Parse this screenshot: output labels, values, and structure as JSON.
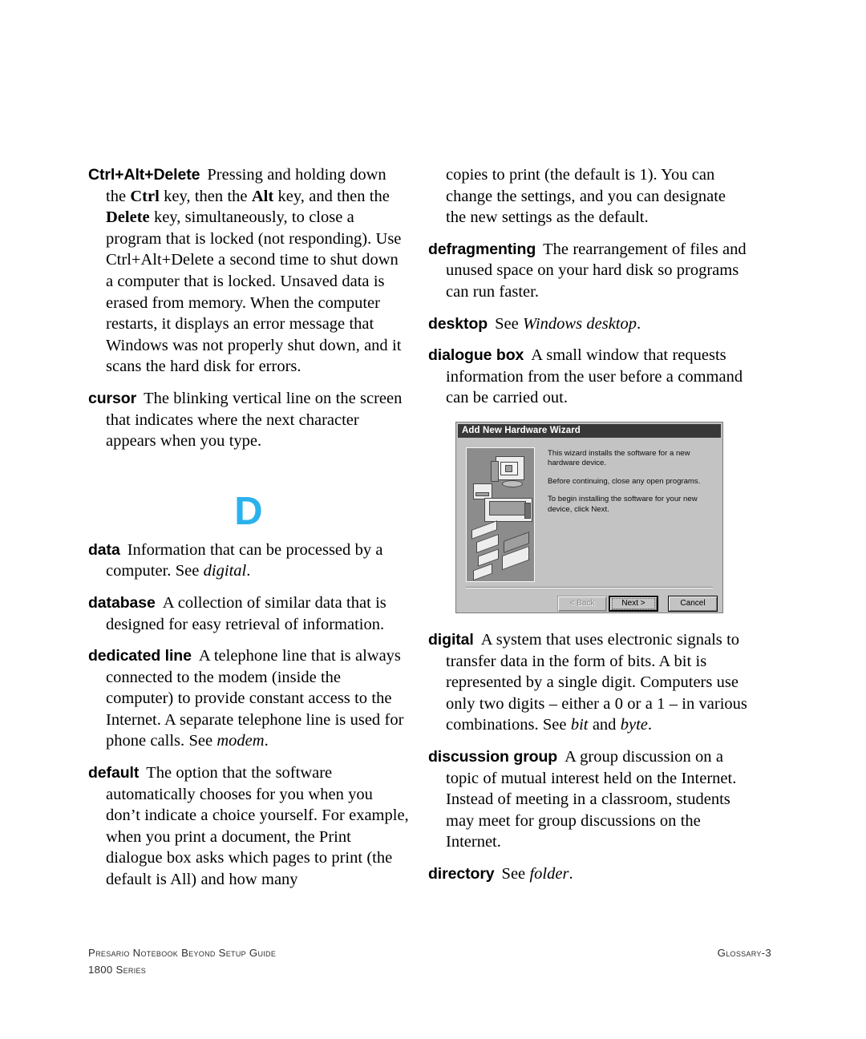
{
  "page": {
    "section_letter": "D",
    "section_letter_color": "#2BB2EC"
  },
  "columns": {
    "left": [
      {
        "id": "ctrl-alt-delete",
        "term": "Ctrl+Alt+Delete",
        "definition_parts": [
          {
            "text": "Pressing and holding down the ",
            "style": "normal"
          },
          {
            "text": "Ctrl",
            "style": "bold"
          },
          {
            "text": " key, then the ",
            "style": "normal"
          },
          {
            "text": "Alt",
            "style": "bold"
          },
          {
            "text": " key, and then the ",
            "style": "normal"
          },
          {
            "text": "Delete",
            "style": "bold"
          },
          {
            "text": " key, simultaneously, to close a program that is locked (not responding). Use Ctrl+Alt+Delete a second time to shut down a computer that is locked. Unsaved data is erased from memory. When the computer restarts, it displays an error message that Windows was not properly shut down, and it scans the hard disk for errors.",
            "style": "normal"
          }
        ]
      },
      {
        "id": "cursor",
        "term": "cursor",
        "definition_parts": [
          {
            "text": "The blinking vertical line on the screen that indicates where the next character appears when you type.",
            "style": "normal"
          }
        ]
      },
      {
        "id": "data",
        "term": "data",
        "definition_parts": [
          {
            "text": "Information that can be processed by a computer. See ",
            "style": "normal"
          },
          {
            "text": "digital",
            "style": "italic"
          },
          {
            "text": ".",
            "style": "normal"
          }
        ]
      },
      {
        "id": "database",
        "term": "database",
        "definition_parts": [
          {
            "text": "A collection of similar data that is designed for easy retrieval of information.",
            "style": "normal"
          }
        ]
      },
      {
        "id": "dedicated-line",
        "term": "dedicated line",
        "definition_parts": [
          {
            "text": "A telephone line that is always connected to the modem (inside the computer) to provide constant access to the Internet. A separate telephone line is used for phone calls. See ",
            "style": "normal"
          },
          {
            "text": "modem",
            "style": "italic"
          },
          {
            "text": ".",
            "style": "normal"
          }
        ]
      },
      {
        "id": "default",
        "term": "default",
        "definition_parts": [
          {
            "text": "The option that the software automatically chooses for you when you don’t indicate a choice yourself. For example, when you print a document, the Print dialogue box asks which pages to print (the default is All) and how many",
            "style": "normal"
          }
        ]
      }
    ],
    "right": [
      {
        "id": "default-continued",
        "term": "",
        "continuation": true,
        "definition_parts": [
          {
            "text": "copies to print (the default is 1). You can change the  settings, and you can designate the new settings as the default.",
            "style": "normal"
          }
        ]
      },
      {
        "id": "defragmenting",
        "term": "defragmenting",
        "definition_parts": [
          {
            "text": "The rearrangement of files and unused space on your hard disk so programs can run faster.",
            "style": "normal"
          }
        ]
      },
      {
        "id": "desktop",
        "term": "desktop",
        "definition_parts": [
          {
            "text": "See ",
            "style": "normal"
          },
          {
            "text": "Windows desktop",
            "style": "italic"
          },
          {
            "text": ".",
            "style": "normal"
          }
        ]
      },
      {
        "id": "dialogue-box",
        "term": "dialogue box",
        "definition_parts": [
          {
            "text": "A small window that requests information from the user before a command can be carried out.",
            "style": "normal"
          }
        ]
      }
    ],
    "right_below_figure": [
      {
        "id": "digital",
        "term": "digital",
        "definition_parts": [
          {
            "text": "A system that uses electronic signals to transfer data in the form of bits. A bit is represented by a single digit. Computers use only two digits – either a 0 or a 1 – in various combinations. See ",
            "style": "normal"
          },
          {
            "text": "bit",
            "style": "italic"
          },
          {
            "text": " and ",
            "style": "normal"
          },
          {
            "text": "byte",
            "style": "italic"
          },
          {
            "text": ".",
            "style": "normal"
          }
        ]
      },
      {
        "id": "discussion-group",
        "term": "discussion group",
        "definition_parts": [
          {
            "text": "A group discussion on a topic of mutual interest held on the Internet.  Instead of meeting in a classroom, students may meet for group discussions on the Internet.",
            "style": "normal"
          }
        ]
      },
      {
        "id": "directory",
        "term": "directory",
        "definition_parts": [
          {
            "text": "See ",
            "style": "normal"
          },
          {
            "text": "folder",
            "style": "italic"
          },
          {
            "text": ".",
            "style": "normal"
          }
        ]
      }
    ]
  },
  "figure": {
    "name": "add-new-hardware-wizard-screenshot",
    "title": "Add New Hardware Wizard",
    "paragraphs": [
      "This wizard installs the software for a new hardware device.",
      "Before continuing, close any open programs.",
      "To begin installing the software for your new device, click Next."
    ],
    "buttons": {
      "back": "< Back",
      "next": "Next >",
      "cancel": "Cancel"
    }
  },
  "footer": {
    "line1": "Presario Notebook Beyond Setup Guide",
    "line2": "1800 Series",
    "page_label": "Glossary-3"
  }
}
